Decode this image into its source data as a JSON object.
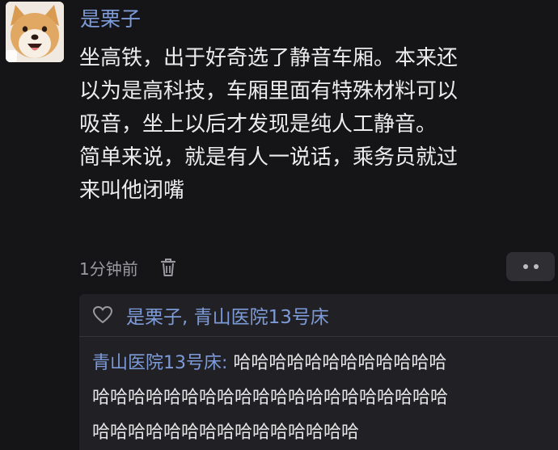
{
  "post": {
    "username": "是栗子",
    "content_lines": [
      "坐高铁，出于好奇选了静音车厢。本来还",
      "以为是高科技，车厢里面有特殊材料可以",
      "吸音，坐上以后才发现是纯人工静音。",
      "简单来说，就是有人一说话，乘务员就过",
      "来叫他闭嘴"
    ],
    "time": "1分钟前",
    "avatar_icon": "shiba-dog-avatar",
    "delete_icon": "trash-icon",
    "more_icon": "more-dots-icon"
  },
  "reply_box": {
    "like_icon": "heart-outline-icon",
    "likers": "是栗子, 青山医院13号床",
    "reply_author": "青山医院13号床:",
    "reply_lines": [
      " 哈哈哈哈哈哈哈哈哈哈哈哈",
      "哈哈哈哈哈哈哈哈哈哈哈哈哈哈哈哈哈哈哈哈",
      "哈哈哈哈哈哈哈哈哈哈哈哈哈哈哈"
    ]
  },
  "colors": {
    "background": "#151518",
    "name_link": "#7d9bd8",
    "text": "#ececec",
    "muted": "#9a9aa0",
    "reply_bg": "#212125"
  }
}
